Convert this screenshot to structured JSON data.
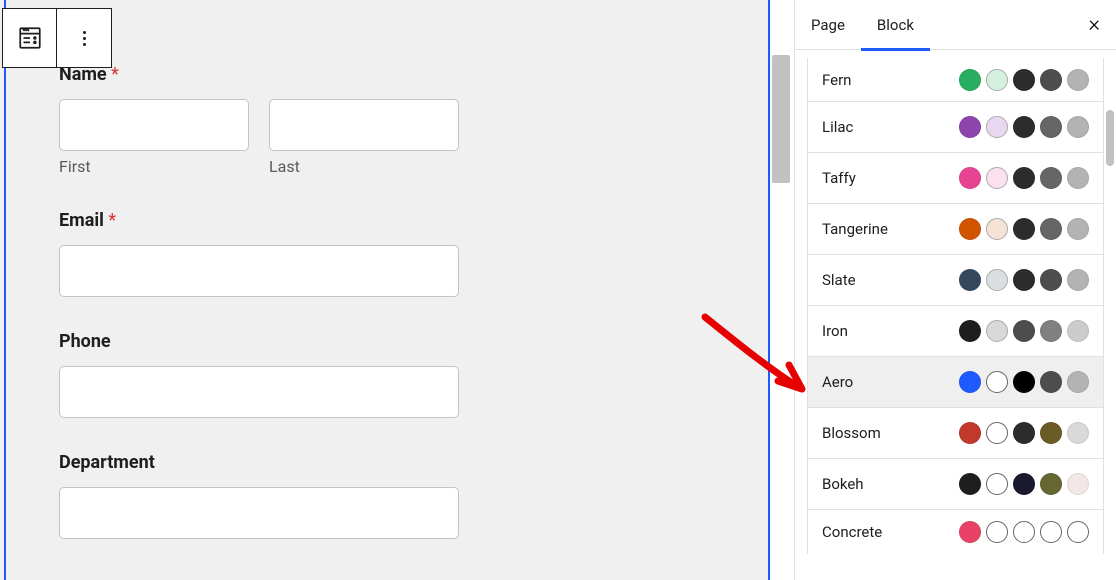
{
  "toolbar": {
    "block_icon": "form-icon",
    "more_icon": "more-vertical-icon"
  },
  "form": {
    "name": {
      "label": "Name",
      "required": "*",
      "first": "First",
      "last": "Last"
    },
    "email": {
      "label": "Email",
      "required": "*"
    },
    "phone": {
      "label": "Phone"
    },
    "department": {
      "label": "Department"
    }
  },
  "sidebar": {
    "tabs": {
      "page": "Page",
      "block": "Block"
    },
    "close": "×",
    "themes": [
      {
        "name": "Fern",
        "colors": [
          "#27ae60",
          "#d5f0df",
          "#2c2c2c",
          "#4d4d4d",
          "#b3b3b3"
        ]
      },
      {
        "name": "Lilac",
        "colors": [
          "#8e44ad",
          "#ead7f2",
          "#2c2c2c",
          "#666666",
          "#b3b3b3"
        ]
      },
      {
        "name": "Taffy",
        "colors": [
          "#e84393",
          "#fbe0ef",
          "#2c2c2c",
          "#666666",
          "#b3b3b3"
        ]
      },
      {
        "name": "Tangerine",
        "colors": [
          "#d35400",
          "#f6e3d5",
          "#2c2c2c",
          "#666666",
          "#b3b3b3"
        ]
      },
      {
        "name": "Slate",
        "colors": [
          "#34495e",
          "#d9dee3",
          "#2c2c2c",
          "#4d4d4d",
          "#b3b3b3"
        ]
      },
      {
        "name": "Iron",
        "colors": [
          "#1e1e1e",
          "#d9d9d9",
          "#4d4d4d",
          "#808080",
          "#cccccc"
        ]
      },
      {
        "name": "Aero",
        "colors": [
          "#1e5bff",
          "#ffffff",
          "#000000",
          "#4d4d4d",
          "#b3b3b3"
        ],
        "selected": true
      },
      {
        "name": "Blossom",
        "colors": [
          "#c0392b",
          "#ffffff",
          "#2c2c2c",
          "#6b5b27",
          "#d9d9d9"
        ]
      },
      {
        "name": "Bokeh",
        "colors": [
          "#1e1e1e",
          "#ffffff",
          "#1a1a2e",
          "#666633",
          "#f2e6e6"
        ]
      },
      {
        "name": "Concrete",
        "colors": [
          "#e84367",
          "#ffffff",
          "#ffffff",
          "#ffffff",
          "#ffffff"
        ]
      }
    ]
  }
}
